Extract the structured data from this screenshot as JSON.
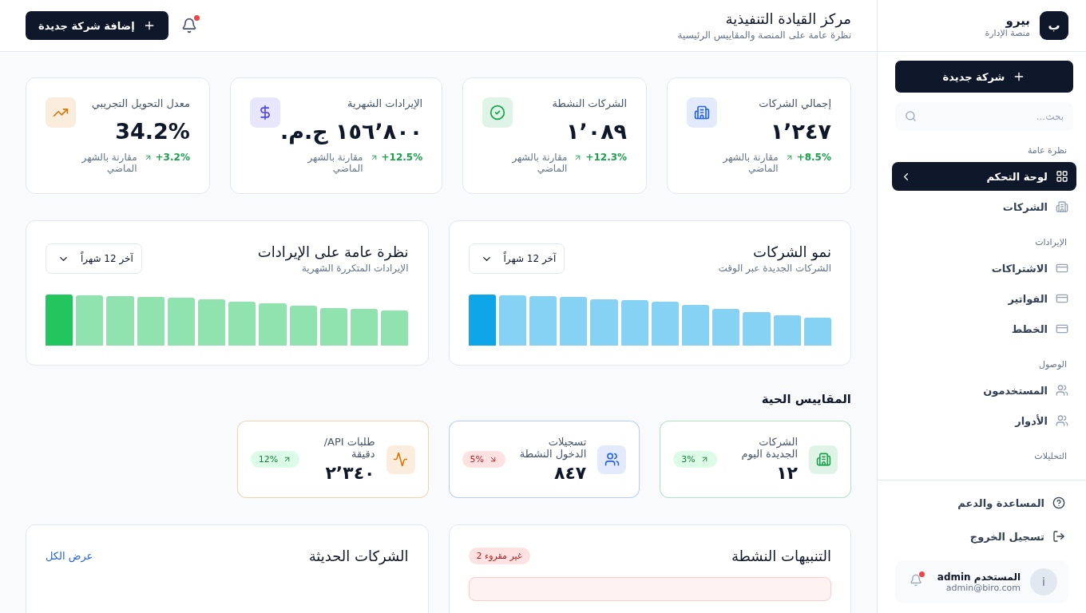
{
  "header": {
    "title": "مركز القيادة التنفيذية",
    "subtitle": "نظرة عامة على المنصة والمقاييس الرئيسية",
    "notifications_unread": true,
    "add_button": "إضافة شركة جديدة"
  },
  "stats": [
    {
      "kind": "total",
      "title": "إجمالي الشركات",
      "value": "١٬٢٤٧",
      "change": "+8.5%",
      "note": "مقارنة بالشهر الماضي",
      "color": "#2563eb"
    },
    {
      "kind": "active",
      "title": "الشركات النشطة",
      "value": "١٬٠٨٩",
      "change": "+12.3%",
      "note": "مقارنة بالشهر الماضي",
      "color": "#16a34a"
    },
    {
      "kind": "revenue",
      "title": "الإيرادات الشهرية",
      "value": "١٥٦٬٨٠٠ ج.م.",
      "change": "+12.5%",
      "note": "مقارنة بالشهر الماضي",
      "color": "#4f46e5"
    },
    {
      "kind": "conversion",
      "title": "معدل التحويل التجريبي",
      "value": "34.2%",
      "change": "+3.2%",
      "note": "مقارنة بالشهر الماضي",
      "color": "#d97706"
    }
  ],
  "charts": [
    {
      "title": "نمو الشركات",
      "subtitle": "الشركات الجديدة عبر الوقت",
      "period": "آخر 12 شهراً",
      "color": "#0ea5e9"
    },
    {
      "title": "نظرة عامة على الإيرادات",
      "subtitle": "الإيرادات المتكررة الشهرية",
      "period": "آخر 12 شهراً",
      "color": "#22c55e"
    }
  ],
  "live_metrics": {
    "title": "المقاييس الحية",
    "items": [
      {
        "kind": "companies",
        "title": "الشركات الجديدة اليوم",
        "value": "١٢",
        "change": "3%",
        "rising": true,
        "color": "#16a34a"
      },
      {
        "kind": "logins",
        "title": "تسجيلات الدخول النشطة",
        "value": "٨٤٧",
        "change": "5%",
        "rising": false,
        "color": "#2563eb"
      },
      {
        "kind": "api",
        "title": "طلبات API/دقيقة",
        "value": "٢٬٣٤٠",
        "change": "12%",
        "rising": true,
        "color": "#d97706"
      }
    ]
  },
  "alerts": {
    "title": "التنبيهات النشطة",
    "badge": "2 غير مقروء"
  },
  "recent": {
    "title": "الشركات الحديثة",
    "link": "عرض الكل"
  },
  "sidebar": {
    "logo_letter": "ب",
    "brand": "بيرو",
    "tagline": "منصة الإدارة",
    "new_button": "شركة جديدة",
    "search_placeholder": "بحث...",
    "sections": [
      {
        "title": "نظرة عامة",
        "items": [
          {
            "label": "لوحة التحكم",
            "kind": "grid",
            "selected": true
          },
          {
            "label": "الشركات",
            "kind": "building",
            "selected": false
          }
        ]
      },
      {
        "title": "الإيرادات",
        "items": [
          {
            "label": "الاشتراكات",
            "kind": "card",
            "selected": false
          },
          {
            "label": "الفواتير",
            "kind": "card",
            "selected": false
          },
          {
            "label": "الخطط",
            "kind": "card",
            "selected": false
          }
        ]
      },
      {
        "title": "الوصول",
        "items": [
          {
            "label": "المستخدمون",
            "kind": "users",
            "selected": false
          },
          {
            "label": "الأدوار",
            "kind": "users",
            "selected": false
          }
        ]
      },
      {
        "title": "التحليلات"
      }
    ],
    "footer": [
      {
        "label": "المساعدة والدعم",
        "kind": "help"
      },
      {
        "label": "تسجيل الخروج",
        "kind": "logout"
      }
    ],
    "user": {
      "avatar": "i",
      "name": "المستخدم admin",
      "email": "admin@biro.com",
      "notifications_unread": true
    }
  }
}
